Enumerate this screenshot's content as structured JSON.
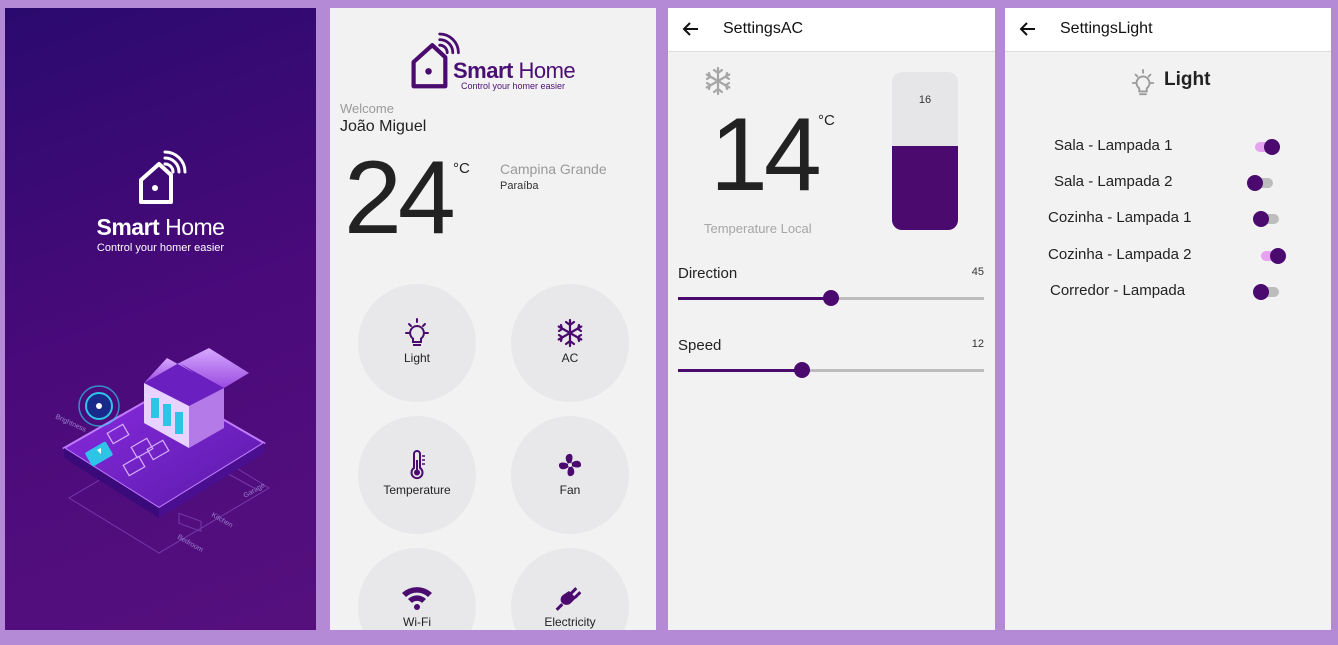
{
  "colors": {
    "primary": "#4a0a6e",
    "frame": "#b48ad6",
    "switch_on_track": "#e6a3f0"
  },
  "splash": {
    "brand_bold": "Smart",
    "brand_light": "Home",
    "tagline": "Control your homer easier",
    "illustration_labels": [
      "Brightness",
      "Garage",
      "Kitchen",
      "Bedroom"
    ]
  },
  "home": {
    "brand_bold": "Smart",
    "brand_light": "Home",
    "tagline": "Control your homer easier",
    "welcome": "Welcome",
    "user_name": "João Miguel",
    "temperature": "24",
    "unit": "°C",
    "city": "Campina Grande",
    "state": "Paraíba",
    "tiles": [
      {
        "label": "Light",
        "icon": "lightbulb-icon"
      },
      {
        "label": "AC",
        "icon": "snowflake-icon"
      },
      {
        "label": "Temperature",
        "icon": "thermometer-icon"
      },
      {
        "label": "Fan",
        "icon": "fan-icon"
      },
      {
        "label": "Wi-Fi",
        "icon": "wifi-icon"
      },
      {
        "label": "Electricity",
        "icon": "plug-icon"
      }
    ]
  },
  "ac": {
    "title": "SettingsAC",
    "temperature": "14",
    "unit": "°C",
    "temperature_label": "Temperature Local",
    "setpoint": "16",
    "setpoint_fill": 0.53,
    "direction": {
      "label": "Direction",
      "value": "45",
      "fraction": 0.5
    },
    "speed": {
      "label": "Speed",
      "value": "12",
      "fraction": 0.405
    }
  },
  "light": {
    "title": "SettingsLight",
    "heading": "Light",
    "lamps": [
      {
        "label": "Sala - Lampada 1",
        "on": true
      },
      {
        "label": "Sala - Lampada 2",
        "on": false
      },
      {
        "label": "Cozinha - Lampada 1",
        "on": false
      },
      {
        "label": "Cozinha - Lampada 2",
        "on": true
      },
      {
        "label": "Corredor - Lampada",
        "on": false
      }
    ]
  }
}
